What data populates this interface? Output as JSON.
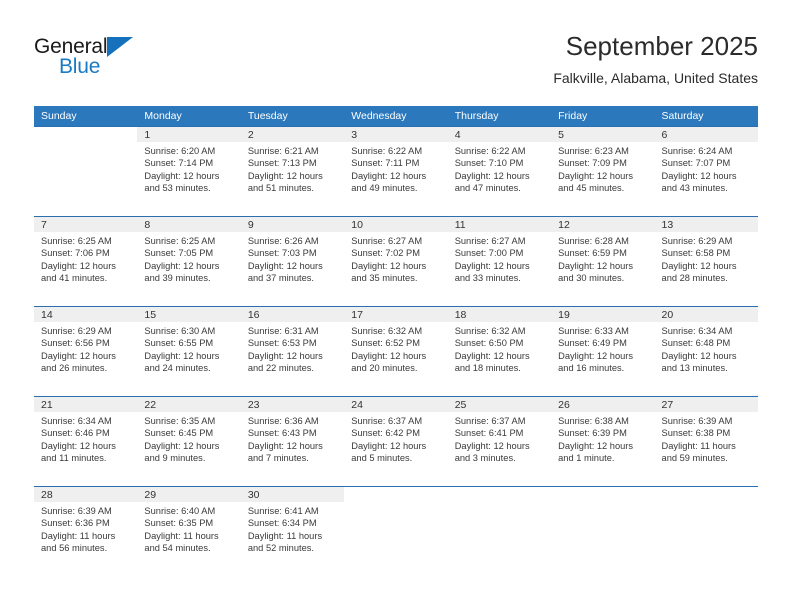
{
  "brand": {
    "name_top": "General",
    "name_bottom": "Blue",
    "accent_color": "#1a7bc4"
  },
  "header": {
    "title": "September 2025",
    "subtitle": "Falkville, Alabama, United States"
  },
  "theme": {
    "header_row_bg": "#2b78bc",
    "daynum_band_bg": "#efefef",
    "row_divider": "#2b6fb0"
  },
  "weekday_headers": [
    "Sunday",
    "Monday",
    "Tuesday",
    "Wednesday",
    "Thursday",
    "Friday",
    "Saturday"
  ],
  "weeks": [
    [
      {
        "day": "",
        "blank": true,
        "sunrise": "",
        "sunset": "",
        "daylight_line1": "",
        "daylight_line2": ""
      },
      {
        "day": "1",
        "blank": false,
        "sunrise": "Sunrise: 6:20 AM",
        "sunset": "Sunset: 7:14 PM",
        "daylight_line1": "Daylight: 12 hours",
        "daylight_line2": "and 53 minutes."
      },
      {
        "day": "2",
        "blank": false,
        "sunrise": "Sunrise: 6:21 AM",
        "sunset": "Sunset: 7:13 PM",
        "daylight_line1": "Daylight: 12 hours",
        "daylight_line2": "and 51 minutes."
      },
      {
        "day": "3",
        "blank": false,
        "sunrise": "Sunrise: 6:22 AM",
        "sunset": "Sunset: 7:11 PM",
        "daylight_line1": "Daylight: 12 hours",
        "daylight_line2": "and 49 minutes."
      },
      {
        "day": "4",
        "blank": false,
        "sunrise": "Sunrise: 6:22 AM",
        "sunset": "Sunset: 7:10 PM",
        "daylight_line1": "Daylight: 12 hours",
        "daylight_line2": "and 47 minutes."
      },
      {
        "day": "5",
        "blank": false,
        "sunrise": "Sunrise: 6:23 AM",
        "sunset": "Sunset: 7:09 PM",
        "daylight_line1": "Daylight: 12 hours",
        "daylight_line2": "and 45 minutes."
      },
      {
        "day": "6",
        "blank": false,
        "sunrise": "Sunrise: 6:24 AM",
        "sunset": "Sunset: 7:07 PM",
        "daylight_line1": "Daylight: 12 hours",
        "daylight_line2": "and 43 minutes."
      }
    ],
    [
      {
        "day": "7",
        "blank": false,
        "sunrise": "Sunrise: 6:25 AM",
        "sunset": "Sunset: 7:06 PM",
        "daylight_line1": "Daylight: 12 hours",
        "daylight_line2": "and 41 minutes."
      },
      {
        "day": "8",
        "blank": false,
        "sunrise": "Sunrise: 6:25 AM",
        "sunset": "Sunset: 7:05 PM",
        "daylight_line1": "Daylight: 12 hours",
        "daylight_line2": "and 39 minutes."
      },
      {
        "day": "9",
        "blank": false,
        "sunrise": "Sunrise: 6:26 AM",
        "sunset": "Sunset: 7:03 PM",
        "daylight_line1": "Daylight: 12 hours",
        "daylight_line2": "and 37 minutes."
      },
      {
        "day": "10",
        "blank": false,
        "sunrise": "Sunrise: 6:27 AM",
        "sunset": "Sunset: 7:02 PM",
        "daylight_line1": "Daylight: 12 hours",
        "daylight_line2": "and 35 minutes."
      },
      {
        "day": "11",
        "blank": false,
        "sunrise": "Sunrise: 6:27 AM",
        "sunset": "Sunset: 7:00 PM",
        "daylight_line1": "Daylight: 12 hours",
        "daylight_line2": "and 33 minutes."
      },
      {
        "day": "12",
        "blank": false,
        "sunrise": "Sunrise: 6:28 AM",
        "sunset": "Sunset: 6:59 PM",
        "daylight_line1": "Daylight: 12 hours",
        "daylight_line2": "and 30 minutes."
      },
      {
        "day": "13",
        "blank": false,
        "sunrise": "Sunrise: 6:29 AM",
        "sunset": "Sunset: 6:58 PM",
        "daylight_line1": "Daylight: 12 hours",
        "daylight_line2": "and 28 minutes."
      }
    ],
    [
      {
        "day": "14",
        "blank": false,
        "sunrise": "Sunrise: 6:29 AM",
        "sunset": "Sunset: 6:56 PM",
        "daylight_line1": "Daylight: 12 hours",
        "daylight_line2": "and 26 minutes."
      },
      {
        "day": "15",
        "blank": false,
        "sunrise": "Sunrise: 6:30 AM",
        "sunset": "Sunset: 6:55 PM",
        "daylight_line1": "Daylight: 12 hours",
        "daylight_line2": "and 24 minutes."
      },
      {
        "day": "16",
        "blank": false,
        "sunrise": "Sunrise: 6:31 AM",
        "sunset": "Sunset: 6:53 PM",
        "daylight_line1": "Daylight: 12 hours",
        "daylight_line2": "and 22 minutes."
      },
      {
        "day": "17",
        "blank": false,
        "sunrise": "Sunrise: 6:32 AM",
        "sunset": "Sunset: 6:52 PM",
        "daylight_line1": "Daylight: 12 hours",
        "daylight_line2": "and 20 minutes."
      },
      {
        "day": "18",
        "blank": false,
        "sunrise": "Sunrise: 6:32 AM",
        "sunset": "Sunset: 6:50 PM",
        "daylight_line1": "Daylight: 12 hours",
        "daylight_line2": "and 18 minutes."
      },
      {
        "day": "19",
        "blank": false,
        "sunrise": "Sunrise: 6:33 AM",
        "sunset": "Sunset: 6:49 PM",
        "daylight_line1": "Daylight: 12 hours",
        "daylight_line2": "and 16 minutes."
      },
      {
        "day": "20",
        "blank": false,
        "sunrise": "Sunrise: 6:34 AM",
        "sunset": "Sunset: 6:48 PM",
        "daylight_line1": "Daylight: 12 hours",
        "daylight_line2": "and 13 minutes."
      }
    ],
    [
      {
        "day": "21",
        "blank": false,
        "sunrise": "Sunrise: 6:34 AM",
        "sunset": "Sunset: 6:46 PM",
        "daylight_line1": "Daylight: 12 hours",
        "daylight_line2": "and 11 minutes."
      },
      {
        "day": "22",
        "blank": false,
        "sunrise": "Sunrise: 6:35 AM",
        "sunset": "Sunset: 6:45 PM",
        "daylight_line1": "Daylight: 12 hours",
        "daylight_line2": "and 9 minutes."
      },
      {
        "day": "23",
        "blank": false,
        "sunrise": "Sunrise: 6:36 AM",
        "sunset": "Sunset: 6:43 PM",
        "daylight_line1": "Daylight: 12 hours",
        "daylight_line2": "and 7 minutes."
      },
      {
        "day": "24",
        "blank": false,
        "sunrise": "Sunrise: 6:37 AM",
        "sunset": "Sunset: 6:42 PM",
        "daylight_line1": "Daylight: 12 hours",
        "daylight_line2": "and 5 minutes."
      },
      {
        "day": "25",
        "blank": false,
        "sunrise": "Sunrise: 6:37 AM",
        "sunset": "Sunset: 6:41 PM",
        "daylight_line1": "Daylight: 12 hours",
        "daylight_line2": "and 3 minutes."
      },
      {
        "day": "26",
        "blank": false,
        "sunrise": "Sunrise: 6:38 AM",
        "sunset": "Sunset: 6:39 PM",
        "daylight_line1": "Daylight: 12 hours",
        "daylight_line2": "and 1 minute."
      },
      {
        "day": "27",
        "blank": false,
        "sunrise": "Sunrise: 6:39 AM",
        "sunset": "Sunset: 6:38 PM",
        "daylight_line1": "Daylight: 11 hours",
        "daylight_line2": "and 59 minutes."
      }
    ],
    [
      {
        "day": "28",
        "blank": false,
        "sunrise": "Sunrise: 6:39 AM",
        "sunset": "Sunset: 6:36 PM",
        "daylight_line1": "Daylight: 11 hours",
        "daylight_line2": "and 56 minutes."
      },
      {
        "day": "29",
        "blank": false,
        "sunrise": "Sunrise: 6:40 AM",
        "sunset": "Sunset: 6:35 PM",
        "daylight_line1": "Daylight: 11 hours",
        "daylight_line2": "and 54 minutes."
      },
      {
        "day": "30",
        "blank": false,
        "sunrise": "Sunrise: 6:41 AM",
        "sunset": "Sunset: 6:34 PM",
        "daylight_line1": "Daylight: 11 hours",
        "daylight_line2": "and 52 minutes."
      },
      {
        "day": "",
        "blank": true,
        "sunrise": "",
        "sunset": "",
        "daylight_line1": "",
        "daylight_line2": ""
      },
      {
        "day": "",
        "blank": true,
        "sunrise": "",
        "sunset": "",
        "daylight_line1": "",
        "daylight_line2": ""
      },
      {
        "day": "",
        "blank": true,
        "sunrise": "",
        "sunset": "",
        "daylight_line1": "",
        "daylight_line2": ""
      },
      {
        "day": "",
        "blank": true,
        "sunrise": "",
        "sunset": "",
        "daylight_line1": "",
        "daylight_line2": ""
      }
    ]
  ]
}
